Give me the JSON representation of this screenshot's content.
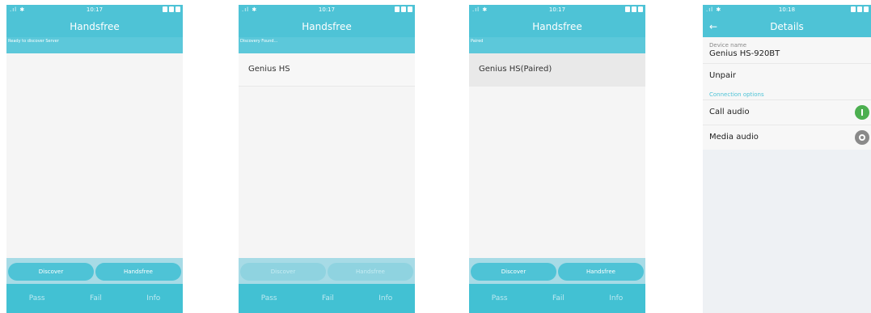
{
  "screens": [
    {
      "time": "10:17",
      "title": "Handsfree",
      "subtitle": "Ready to discover Server",
      "list": [],
      "buttons": {
        "discover": "Discover",
        "handsfree": "Handsfree",
        "enabled": true
      },
      "nav": {
        "pass": "Pass",
        "fail": "Fail",
        "info": "Info"
      }
    },
    {
      "time": "10:17",
      "title": "Handsfree",
      "subtitle": "Discovery Found...",
      "list": [
        "Genius HS"
      ],
      "buttons": {
        "discover": "Discover",
        "handsfree": "Handsfree",
        "enabled": false
      },
      "nav": {
        "pass": "Pass",
        "fail": "Fail",
        "info": "Info"
      }
    },
    {
      "time": "10:17",
      "title": "Handsfree",
      "subtitle": "Paired",
      "list": [
        "Genius HS(Paired)"
      ],
      "buttons": {
        "discover": "Discover",
        "handsfree": "Handsfree",
        "enabled": true
      },
      "nav": {
        "pass": "Pass",
        "fail": "Fail",
        "info": "Info"
      }
    }
  ],
  "details": {
    "time": "10:18",
    "title": "Details",
    "device_name_label": "Device name",
    "device_name": "Genius HS-920BT",
    "unpair": "Unpair",
    "section": "Connection options",
    "call_audio": "Call audio",
    "call_audio_on": true,
    "media_audio": "Media audio",
    "media_audio_on": false
  },
  "colors": {
    "accent": "#4ec3d6",
    "toggle_on": "#4caf50",
    "toggle_off": "#8a8a8a"
  }
}
